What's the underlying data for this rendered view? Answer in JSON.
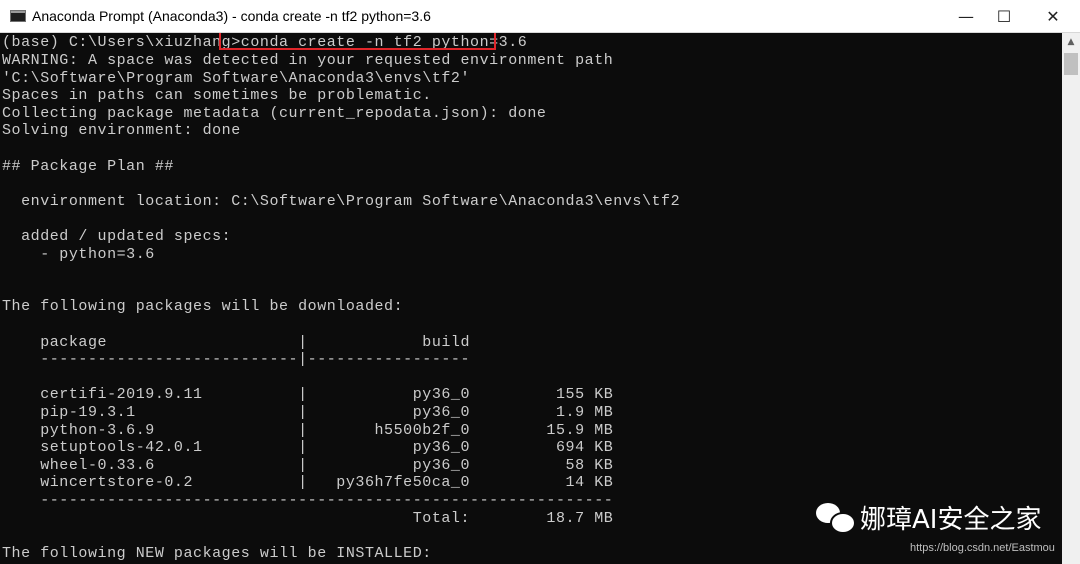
{
  "window": {
    "title": "Anaconda Prompt (Anaconda3) - conda  create -n tf2 python=3.6",
    "minimize_glyph": "—",
    "maximize_glyph": "☐",
    "close_glyph": "✕"
  },
  "console": {
    "prompt": "(base) C:\\Users\\xiuzhang>",
    "command": "conda create -n tf2 python=3.6",
    "lines": [
      "WARNING: A space was detected in your requested environment path",
      "'C:\\Software\\Program Software\\Anaconda3\\envs\\tf2'",
      "Spaces in paths can sometimes be problematic.",
      "Collecting package metadata (current_repodata.json): done",
      "Solving environment: done",
      "",
      "## Package Plan ##",
      "",
      "  environment location: C:\\Software\\Program Software\\Anaconda3\\envs\\tf2",
      "",
      "  added / updated specs:",
      "    - python=3.6",
      "",
      "",
      "The following packages will be downloaded:",
      "",
      "    package                    |            build",
      "    ---------------------------|-----------------",
      "",
      "    certifi-2019.9.11          |           py36_0         155 KB",
      "    pip-19.3.1                 |           py36_0         1.9 MB",
      "    python-3.6.9               |       h5500b2f_0        15.9 MB",
      "    setuptools-42.0.1          |           py36_0         694 KB",
      "    wheel-0.33.6               |           py36_0          58 KB",
      "    wincertstore-0.2           |   py36h7fe50ca_0          14 KB",
      "    ------------------------------------------------------------",
      "                                           Total:        18.7 MB",
      "",
      "The following NEW packages will be INSTALLED:"
    ]
  },
  "scrollbar": {
    "up_arrow": "▲"
  },
  "watermark": {
    "text": "娜璋AI安全之家",
    "url": "https://blog.csdn.net/Eastmou"
  }
}
